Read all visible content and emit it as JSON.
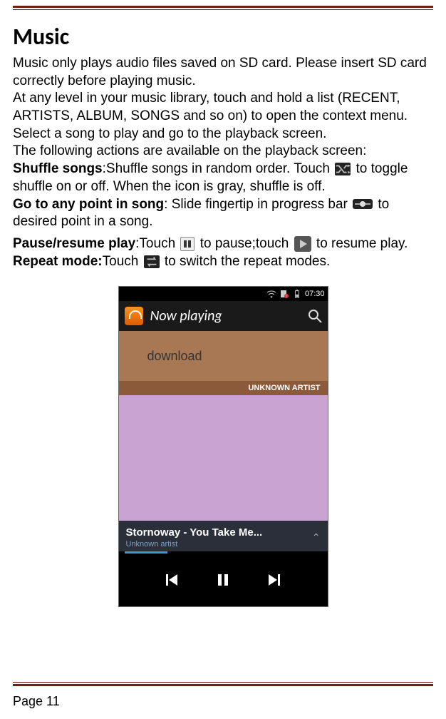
{
  "heading": "Music",
  "paragraphs": {
    "p1": "Music only plays audio files saved on SD card. Please insert SD card correctly before playing music.",
    "p2": "At any level in your music library, touch and hold a list (RECENT, ARTISTS, ALBUM, SONGS and so on) to open the context menu.",
    "p3": "Select a song to play and go to the playback screen.",
    "p4": "The following actions are available on the playback screen:",
    "shuffle_label": "Shuffle songs",
    "shuffle_rest1": ":Shuffle songs in random order. Touch",
    "shuffle_rest2": " to toggle shuffle on or off. When the icon is gray, shuffle is off.",
    "goto_label": "Go to any point in song",
    "goto_rest1": ": Slide fingertip in progress bar",
    "goto_rest2": " to desired point in a song.",
    "pause_label": "Pause/resume play",
    "pause_rest1": ":Touch ",
    "pause_rest2": " to pause;touch",
    "pause_rest3": " to resume play.",
    "repeat_label": "Repeat mode:",
    "repeat_rest1": "Touch",
    "repeat_rest2": " to switch the repeat modes."
  },
  "phone": {
    "time": "07:30",
    "title": "Now playing",
    "album_name": "download",
    "album_artist_label": "UNKNOWN ARTIST",
    "track_title": "Stornoway - You Take Me...",
    "track_artist": "Unknown artist"
  },
  "footer": "Page 11"
}
